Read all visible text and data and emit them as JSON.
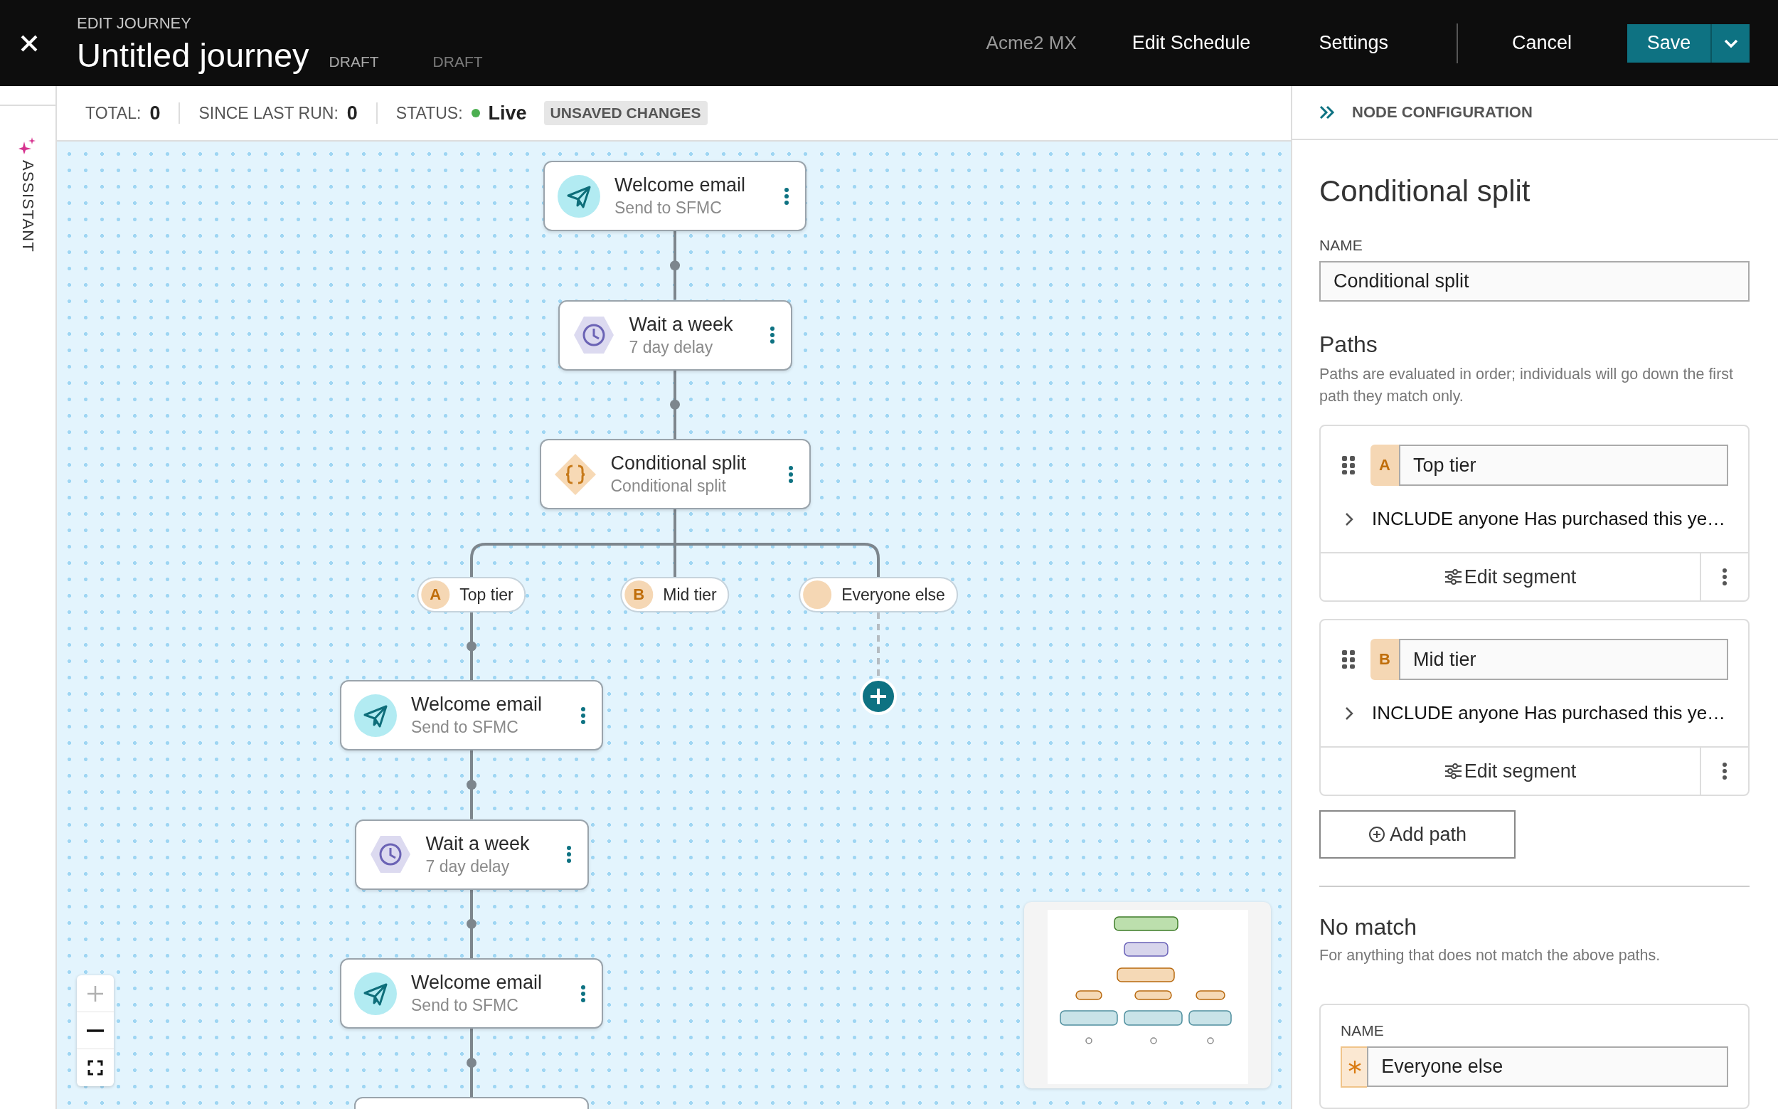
{
  "header": {
    "overline": "EDIT JOURNEY",
    "title": "Untitled journey",
    "badges": [
      "DRAFT",
      "DRAFT"
    ],
    "account": "Acme2 MX",
    "actions": [
      "Edit Schedule",
      "Settings"
    ],
    "cancel": "Cancel",
    "save": "Save"
  },
  "assistant": {
    "label": "ASSISTANT"
  },
  "stats": [
    {
      "label": "TOTAL:",
      "value": "0"
    },
    {
      "label": "SINCE LAST RUN:",
      "value": "0"
    }
  ],
  "status": {
    "label": "STATUS:",
    "value": "Live",
    "live": true
  },
  "unsaved_badge": "UNSAVED CHANGES",
  "canvas": {
    "nodes": [
      {
        "kind": "email",
        "title": "Welcome email",
        "subtitle": "Send to SFMC"
      },
      {
        "kind": "wait",
        "title": "Wait a week",
        "subtitle": "7 day delay"
      },
      {
        "kind": "split",
        "title": "Conditional split",
        "subtitle": "Conditional split"
      }
    ],
    "paths": [
      {
        "letter": "A",
        "label": "Top tier",
        "nodes": [
          {
            "kind": "email",
            "title": "Welcome email",
            "subtitle": "Send to SFMC"
          },
          {
            "kind": "wait",
            "title": "Wait a week",
            "subtitle": "7 day delay"
          },
          {
            "kind": "email",
            "title": "Welcome email",
            "subtitle": "Send to SFMC"
          }
        ]
      },
      {
        "letter": "B",
        "label": "Mid tier"
      },
      {
        "label": "Everyone else",
        "add_button": true
      }
    ]
  },
  "panel": {
    "header": "NODE CONFIGURATION",
    "title": "Conditional split",
    "name_label": "NAME",
    "name_value": "Conditional split",
    "paths_heading": "Paths",
    "paths_description": "Paths are evaluated in order; individuals will go down the first path they match only.",
    "paths": [
      {
        "letter": "A",
        "name": "Top tier",
        "rule": "INCLUDE anyone Has purchased this ye…",
        "edit": "Edit segment"
      },
      {
        "letter": "B",
        "name": "Mid tier",
        "rule": "INCLUDE anyone Has purchased this ye…",
        "edit": "Edit segment"
      }
    ],
    "add_path": "Add path",
    "no_match_heading": "No match",
    "no_match_description": "For anything that does not match the above paths.",
    "no_match_name_label": "NAME",
    "no_match_name": "Everyone else"
  }
}
